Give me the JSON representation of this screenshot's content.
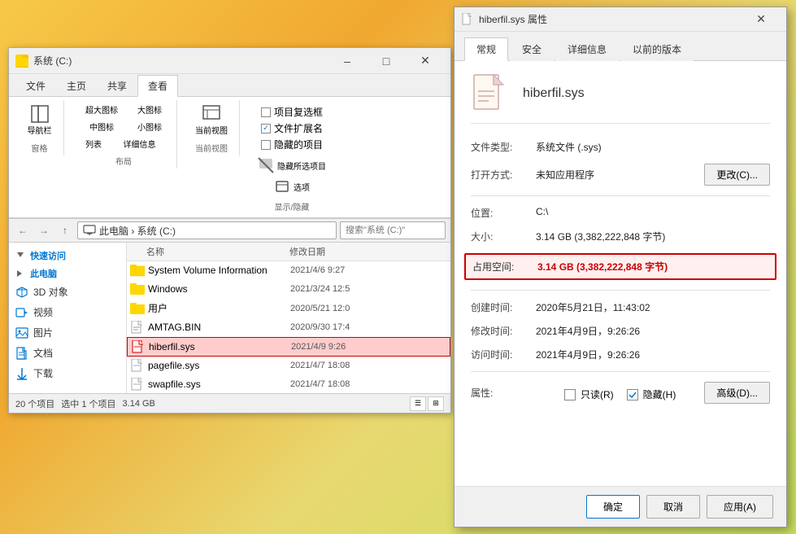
{
  "background": {
    "description": "Yellow citrus background"
  },
  "explorer": {
    "title": "系统 (C:)",
    "tabs": [
      "文件",
      "主页",
      "共享",
      "查看"
    ],
    "active_tab": "查看",
    "ribbon_sections": {
      "panes_label": "窗格",
      "layout_label": "布局",
      "current_view_label": "当前视图",
      "show_hide_label": "显示/隐藏"
    },
    "layout_options": [
      "超大图标",
      "大图标",
      "中图标",
      "小图标",
      "列表",
      "详细信息"
    ],
    "view_checkboxes": [
      {
        "label": "项目复选框",
        "checked": false
      },
      {
        "label": "文件扩展名",
        "checked": true
      },
      {
        "label": "隐藏的项目",
        "checked": false
      }
    ],
    "hide_label": "隐藏所选项目",
    "options_label": "选项",
    "current_view_btn": "当前视图",
    "address": "此电脑 › 系统 (C:)",
    "search_placeholder": "搜索\"系统 (C:)\"",
    "sidebar_items": [
      {
        "label": "快速访问",
        "icon": "star"
      },
      {
        "label": "此电脑",
        "icon": "computer"
      },
      {
        "label": "3D 对象",
        "icon": "cube"
      },
      {
        "label": "视频",
        "icon": "video"
      },
      {
        "label": "图片",
        "icon": "image"
      },
      {
        "label": "文档",
        "icon": "document"
      },
      {
        "label": "下载",
        "icon": "download"
      }
    ],
    "columns": [
      "名称",
      "修改日期"
    ],
    "files": [
      {
        "name": "System Volume Information",
        "date": "2021/4/6  9:27",
        "type": "folder",
        "selected": false,
        "highlighted": false
      },
      {
        "name": "Windows",
        "date": "2021/3/24  12:5",
        "type": "folder",
        "selected": false,
        "highlighted": false
      },
      {
        "name": "用户",
        "date": "2020/5/21  12:0",
        "type": "folder",
        "selected": false,
        "highlighted": false
      },
      {
        "name": "AMTAG.BIN",
        "date": "2020/9/30  17:4",
        "type": "file",
        "selected": false,
        "highlighted": false
      },
      {
        "name": "hiberfil.sys",
        "date": "2021/4/9  9:26",
        "type": "sys",
        "selected": true,
        "highlighted": true
      },
      {
        "name": "pagefile.sys",
        "date": "2021/4/7  18:08",
        "type": "sys",
        "selected": false,
        "highlighted": false
      },
      {
        "name": "swapfile.sys",
        "date": "2021/4/7  18:08",
        "type": "sys",
        "selected": false,
        "highlighted": false
      }
    ],
    "status": "20 个项目",
    "status_selected": "选中 1 个项目",
    "status_size": "3.14 GB"
  },
  "properties": {
    "title": "hiberfil.sys 属性",
    "tabs": [
      "常规",
      "安全",
      "详细信息",
      "以前的版本"
    ],
    "active_tab": "常规",
    "filename": "hiberfil.sys",
    "rows": [
      {
        "label": "文件类型:",
        "value": "系统文件 (.sys)"
      },
      {
        "label": "打开方式:",
        "value": "未知应用程序",
        "has_button": true,
        "button_label": "更改(C)..."
      },
      {
        "label": "位置:",
        "value": "C:\\"
      },
      {
        "label": "大小:",
        "value": "3.14 GB (3,382,222,848 字节)"
      },
      {
        "label": "占用空间:",
        "value": "3.14 GB (3,382,222,848 字节)",
        "highlighted": true
      },
      {
        "label": "创建时间:",
        "value": "2020年5月21日，11:43:02"
      },
      {
        "label": "修改时间:",
        "value": "2021年4月9日，9:26:26"
      },
      {
        "label": "访问时间:",
        "value": "2021年4月9日，9:26:26"
      }
    ],
    "attrs_label": "属性:",
    "attrs": [
      {
        "label": "只读(R)",
        "checked": false
      },
      {
        "label": "隐藏(H)",
        "checked": true
      }
    ],
    "advanced_btn": "高级(D)...",
    "footer_btns": [
      "确定",
      "取消",
      "应用(A)"
    ]
  }
}
